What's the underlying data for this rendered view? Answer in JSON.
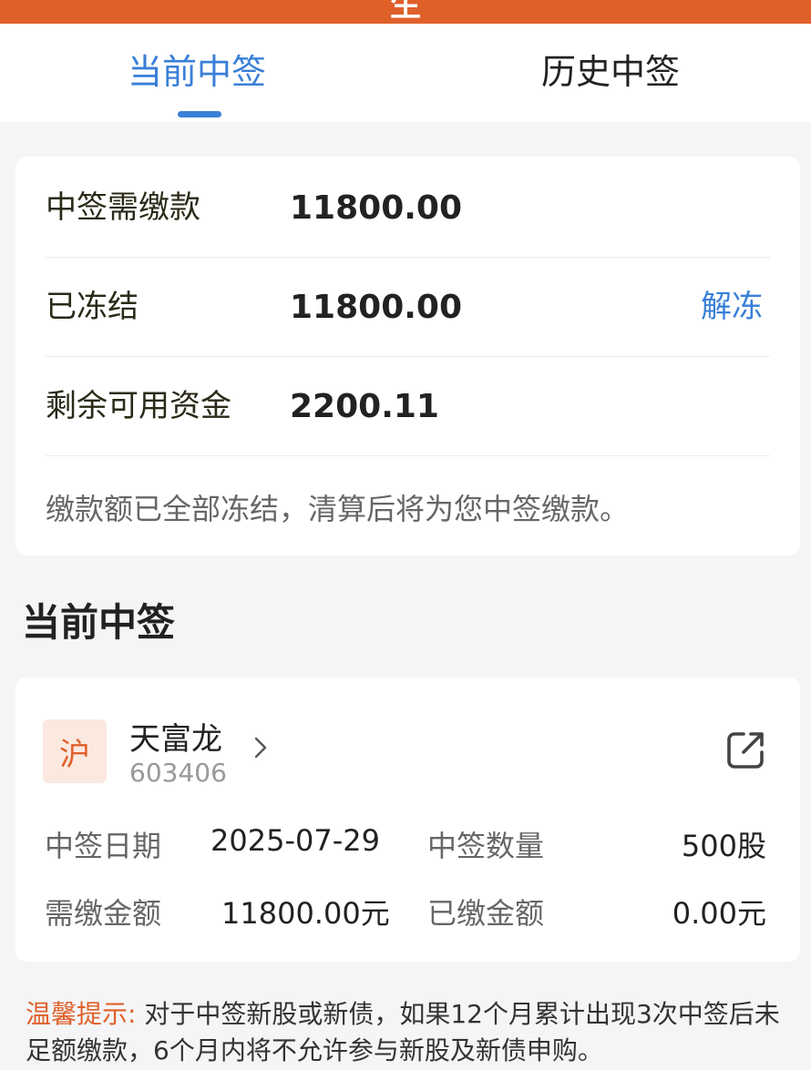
{
  "header": {
    "title": "生"
  },
  "tabs": [
    {
      "label": "当前中签"
    },
    {
      "label": "历史中签"
    }
  ],
  "summary": {
    "rows": [
      {
        "label": "中签需缴款",
        "value": "11800.00"
      },
      {
        "label": "已冻结",
        "value": "11800.00",
        "action": "解冻"
      },
      {
        "label": "剩余可用资金",
        "value": "2200.11"
      }
    ],
    "note": "缴款额已全部冻结，清算后将为您中签缴款。"
  },
  "section": {
    "title": "当前中签"
  },
  "lot": {
    "market": "沪",
    "name": "天富龙",
    "code": "603406",
    "fields": {
      "date_label": "中签日期",
      "date_value": "2025-07-29",
      "qty_label": "中签数量",
      "qty_value": "500股",
      "due_label": "需缴金额",
      "due_value": "11800.00元",
      "paid_label": "已缴金额",
      "paid_value": "0.00元"
    }
  },
  "tip": {
    "label": "温馨提示:",
    "text": "对于中签新股或新债，如果12个月累计出现3次中签后未足额缴款，6个月内将不允许参与新股及新债申购。"
  },
  "colors": {
    "accent": "#3a7fd8",
    "brand": "#e0602a"
  },
  "icons": {
    "chevron": "chevron-right-icon",
    "share": "share-external-icon"
  }
}
